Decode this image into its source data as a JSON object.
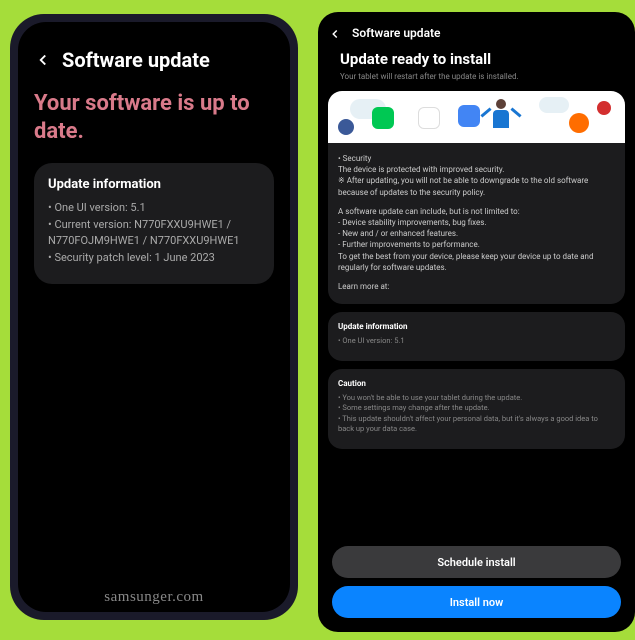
{
  "left": {
    "header_title": "Software update",
    "status_text": "Your software is up to date.",
    "info_title": "Update information",
    "info_lines": [
      "• One UI version: 5.1",
      "• Current version: N770FXXU9HWE1 / N770FOJM9HWE1 / N770FXXU9HWE1",
      "• Security patch level: 1 June 2023"
    ],
    "watermark": "samsunger.com"
  },
  "right": {
    "header_title": "Software update",
    "main_title": "Update ready to install",
    "subtitle": "Your tablet will restart after the update is installed.",
    "desc_lines": [
      "• Security",
      "The device is protected with improved security.",
      "※ After updating, you will not be able to downgrade to the old software because of updates to the security policy.",
      "",
      "A software update can include, but is not limited to:",
      " - Device stability improvements, bug fixes.",
      " - New and / or enhanced features.",
      " - Further improvements to performance.",
      "To get the best from your device, please keep your device up to date and regularly for software updates.",
      "",
      "Learn more at:"
    ],
    "update_info_title": "Update information",
    "update_info_lines": [
      "• One UI version: 5.1"
    ],
    "caution_title": "Caution",
    "caution_lines": [
      "• You won't be able to use your tablet during the update.",
      "• Some settings may change after the update.",
      "• This update shouldn't affect your personal data, but it's always a good idea to back up your data case."
    ],
    "btn_schedule": "Schedule install",
    "btn_install": "Install now"
  }
}
